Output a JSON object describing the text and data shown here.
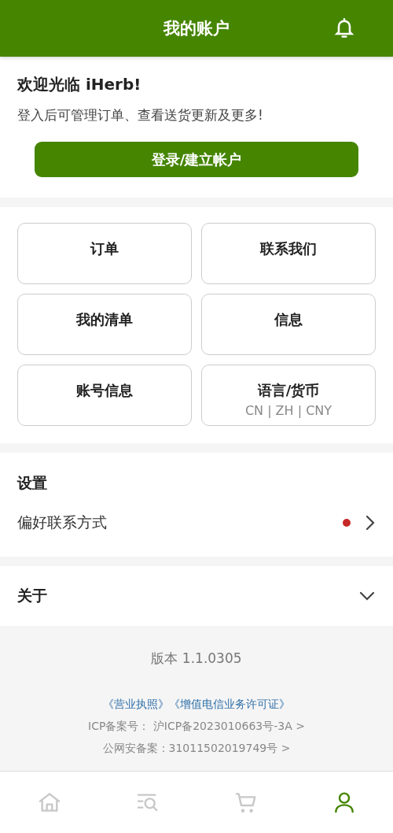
{
  "header": {
    "title": "我的账户"
  },
  "welcome": {
    "title": "欢迎光临 iHerb!",
    "subtitle": "登入后可管理订单、查看送货更新及更多!",
    "button": "登录/建立帐户"
  },
  "tiles": [
    {
      "label": "订单"
    },
    {
      "label": "联系我们"
    },
    {
      "label": "我的清单"
    },
    {
      "label": "信息"
    },
    {
      "label": "账号信息"
    },
    {
      "label": "语言/货币",
      "detail": "CN | ZH | CNY"
    }
  ],
  "settings": {
    "title": "设置",
    "items": [
      {
        "label": "偏好联系方式",
        "alert": true
      }
    ]
  },
  "about": {
    "title": "关于",
    "expanded": false
  },
  "footer": {
    "version": "版本 1.1.0305",
    "links": [
      "《营业执照》",
      "《增值电信业务许可证》"
    ],
    "lines": [
      "ICP备案号： 沪ICP备2023010663号-3A >",
      "公网安备案：31011502019749号 >"
    ]
  },
  "bottom_nav": [
    {
      "kind": "home",
      "selected": false
    },
    {
      "kind": "search",
      "selected": false
    },
    {
      "kind": "cart",
      "selected": false
    },
    {
      "kind": "account",
      "selected": true
    }
  ]
}
